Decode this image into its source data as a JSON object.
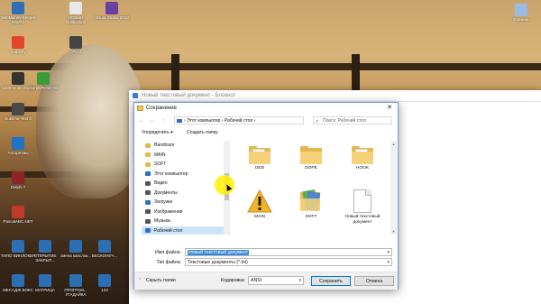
{
  "desktop": {
    "icons_left": [
      {
        "label": "WebMoney Keeper WinPro",
        "color": "#2f6fb8"
      },
      {
        "label": "Audacity",
        "color": "#e0472b"
      },
      {
        "label": "Cinema 4D Studio",
        "color": "#333333"
      },
      {
        "label": "Sublime Text 3",
        "color": "#4a4a4a"
      },
      {
        "label": "Алгоритмы",
        "color": "#1e72c7"
      },
      {
        "label": "Delphi 7",
        "color": "#8b2424"
      },
      {
        "label": "PascalABC.NET",
        "color": "#c03b2b"
      }
    ],
    "icons_top": [
      {
        "label": "НОВЫЙ Notification",
        "color": "#e8e8e8"
      },
      {
        "label": "Visual Studio 2013",
        "color": "#6a3fa0"
      },
      {
        "label": "CPU-Z",
        "color": "#444444"
      },
      {
        "label": "CorelDRAW X8",
        "color": "#3a9b3a"
      }
    ],
    "icon_right": {
      "label": "Корзина",
      "color": "#9dbbe0"
    },
    "icons_bottom": [
      {
        "label": "ТИПО ВИНЛОКЕР",
        "color": "#2c6fb5"
      },
      {
        "label": "ОТКРЫТИЕ ЗАКРЫТ...",
        "color": "#2c6fb5"
      },
      {
        "label": "смена капслок...",
        "color": "#2c6fb5"
      },
      {
        "label": "БЕСКОНЕЧ...",
        "color": "#2c6fb5"
      },
      {
        "label": "МЕСАДЖ БОКС",
        "color": "#2c6fb5"
      },
      {
        "label": "МАТРИЦА",
        "color": "#2c6fb5"
      },
      {
        "label": "ПРОГРАМ... УГАДАЙКА",
        "color": "#2c6fb5"
      },
      {
        "label": "123",
        "color": "#2c6fb5"
      }
    ]
  },
  "notepad": {
    "title": "Новый текстовый документ - Блокнот"
  },
  "dialog": {
    "title": "Сохранение",
    "close_glyph": "✕",
    "nav": {
      "back": "←",
      "forward": "→",
      "up": "↑"
    },
    "breadcrumb": "›  Этот компьютер  ›  Рабочий стол  ›",
    "search_placeholder": "Поиск: Рабочий стол",
    "toolbar": {
      "organize": "Упорядочить ▾",
      "new_folder": "Создать папку"
    },
    "nav_items": [
      {
        "label": "Bandicam",
        "icon": "folder-icon",
        "color": "#e7b74c"
      },
      {
        "label": "MAIN",
        "icon": "folder-icon",
        "color": "#e7b74c"
      },
      {
        "label": "SOFT",
        "icon": "folder-icon",
        "color": "#e7b74c"
      },
      {
        "label": "Этот компьютер",
        "icon": "computer-icon",
        "color": "#2f6fc9"
      },
      {
        "label": "Видео",
        "icon": "video-icon",
        "color": "#555555"
      },
      {
        "label": "Документы",
        "icon": "documents-icon",
        "color": "#555555"
      },
      {
        "label": "Загрузки",
        "icon": "downloads-icon",
        "color": "#2f6fc9"
      },
      {
        "label": "Изображения",
        "icon": "pictures-icon",
        "color": "#555555"
      },
      {
        "label": "Музыка",
        "icon": "music-icon",
        "color": "#555555"
      },
      {
        "label": "Рабочий стол",
        "icon": "desktop-icon",
        "color": "#2f6fc9",
        "selected": true
      }
    ],
    "files": [
      {
        "label": "DED",
        "type": "folder"
      },
      {
        "label": "DOPE",
        "type": "folder"
      },
      {
        "label": "HOOK",
        "type": "folder"
      },
      {
        "label": "MAIN",
        "type": "warning"
      },
      {
        "label": "SOFT",
        "type": "folder-green"
      },
      {
        "label": "Новый текстовый документ",
        "type": "text"
      }
    ],
    "filename_label": "Имя файла:",
    "filename_value": "Новый текстовый документ",
    "filetype_label": "Тип файла:",
    "filetype_value": "Текстовые документы (*.txt)",
    "hide_folders": "Скрыть папки",
    "encoding_label": "Кодировка:",
    "encoding_value": "ANSI",
    "save_button": "Сохранить",
    "cancel_button": "Отмена"
  }
}
